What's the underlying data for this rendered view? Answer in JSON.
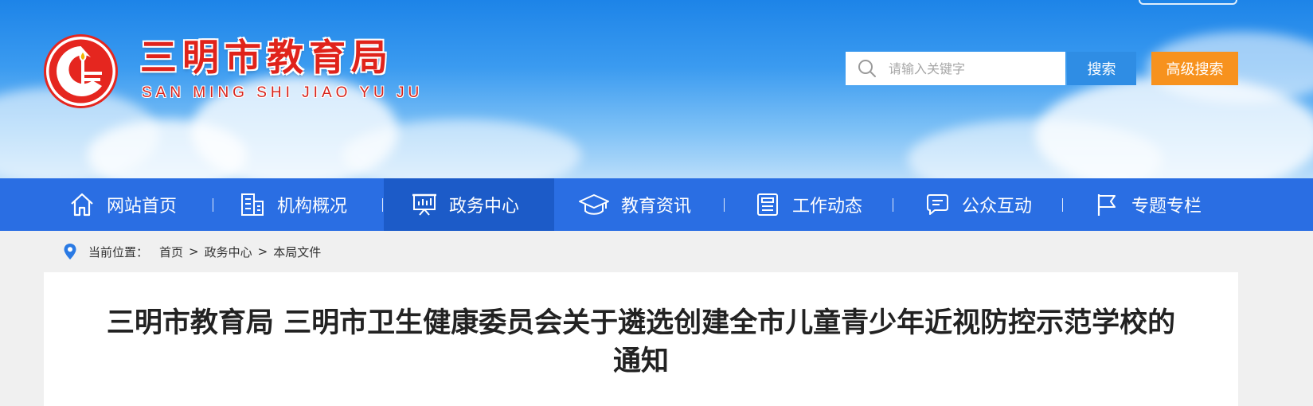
{
  "site": {
    "name": "三明市教育局",
    "pinyin": "SAN MING SHI JIAO YU JU"
  },
  "search": {
    "placeholder": "请输入关键字",
    "button_label": "搜索",
    "advanced_label": "高级搜索"
  },
  "nav": {
    "items": [
      {
        "label": "网站首页",
        "icon": "home-icon"
      },
      {
        "label": "机构概况",
        "icon": "building-icon"
      },
      {
        "label": "政务中心",
        "icon": "presentation-icon",
        "active": true
      },
      {
        "label": "教育资讯",
        "icon": "graduation-cap-icon"
      },
      {
        "label": "工作动态",
        "icon": "news-icon"
      },
      {
        "label": "公众互动",
        "icon": "chat-icon"
      },
      {
        "label": "专题专栏",
        "icon": "flag-icon"
      }
    ]
  },
  "breadcrumb": {
    "label": "当前位置：",
    "items": [
      "首页",
      "政务中心",
      "本局文件"
    ],
    "separator": ">"
  },
  "article": {
    "title": "三明市教育局 三明市卫生健康委员会关于遴选创建全市儿童青少年近视防控示范学校的通知"
  },
  "colors": {
    "nav_bg": "#2a6ee3",
    "nav_active": "#1c5bc8",
    "search_button": "#2f8de4",
    "advanced_button": "#f7921e",
    "brand_red": "#e0231b"
  }
}
